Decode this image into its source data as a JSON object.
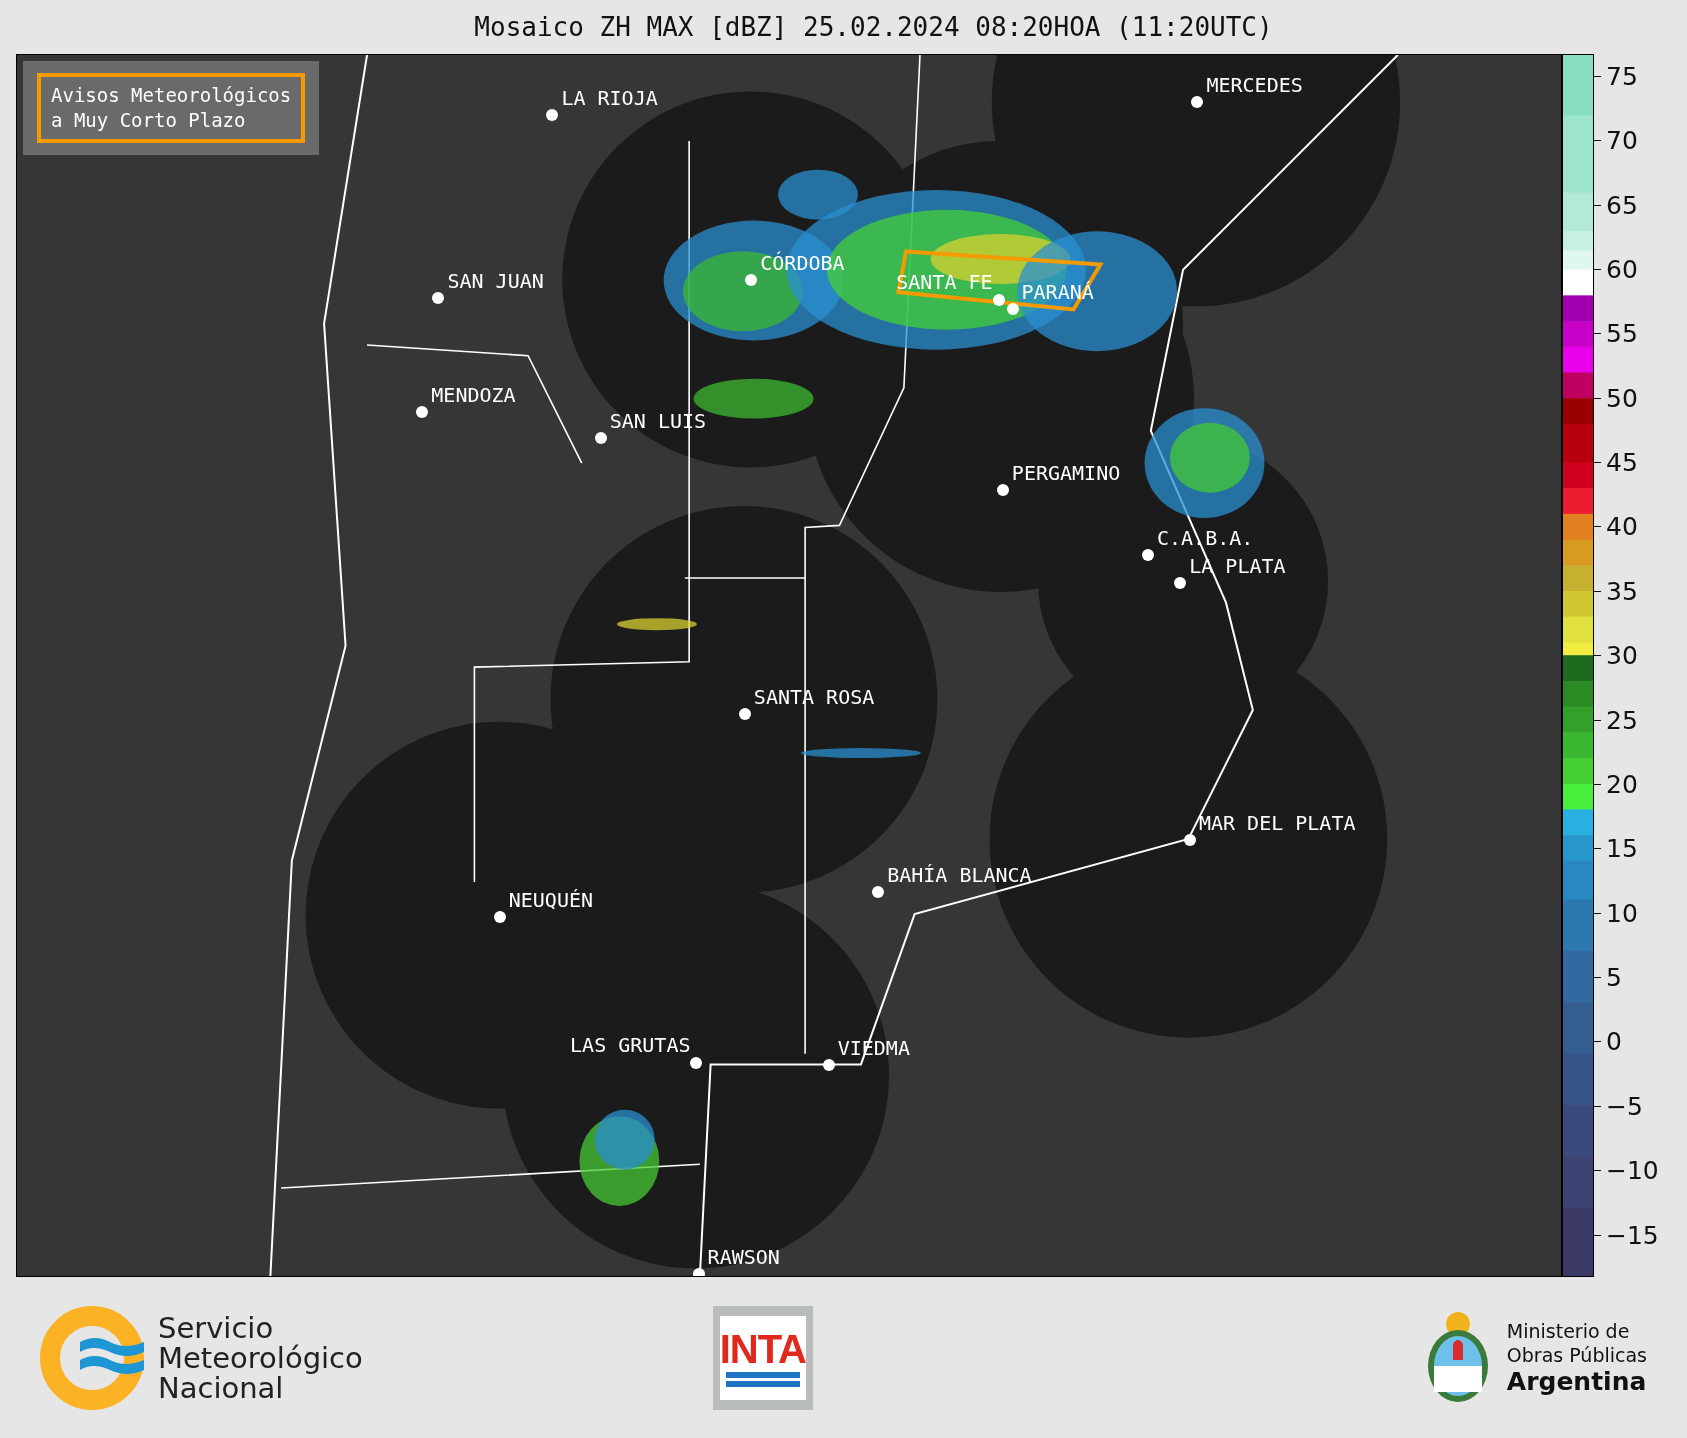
{
  "title": "Mosaico ZH MAX [dBZ] 25.02.2024 08:20HOA (11:20UTC)",
  "warning_box": {
    "lines": [
      "Avisos Meteorológicos",
      "a Muy Corto Plazo"
    ]
  },
  "cities": [
    {
      "name": "LA RIOJA"
    },
    {
      "name": "MERCEDES"
    },
    {
      "name": "CÓRDOBA"
    },
    {
      "name": "SAN JUAN"
    },
    {
      "name": "SANTA FE"
    },
    {
      "name": "PARANÁ"
    },
    {
      "name": "MENDOZA"
    },
    {
      "name": "SAN LUIS"
    },
    {
      "name": "PERGAMINO"
    },
    {
      "name": "C.A.B.A."
    },
    {
      "name": "LA PLATA"
    },
    {
      "name": "SANTA ROSA"
    },
    {
      "name": "MAR DEL PLATA"
    },
    {
      "name": "BAHÍA BLANCA"
    },
    {
      "name": "NEUQUÉN"
    },
    {
      "name": "LAS GRUTAS"
    },
    {
      "name": "VIEDMA"
    },
    {
      "name": "RAWSON"
    }
  ],
  "colorbar": {
    "ticks": [
      "75",
      "70",
      "65",
      "60",
      "55",
      "50",
      "45",
      "40",
      "35",
      "30",
      "25",
      "20",
      "15",
      "10",
      "5",
      "0",
      "−5",
      "−10",
      "−15"
    ]
  },
  "footer": {
    "smn_lines": [
      "Servicio",
      "Meteorológico",
      "Nacional"
    ],
    "inta": "INTA",
    "ministry_lines": [
      "Ministerio de",
      "Obras Públicas",
      "Argentina"
    ]
  }
}
